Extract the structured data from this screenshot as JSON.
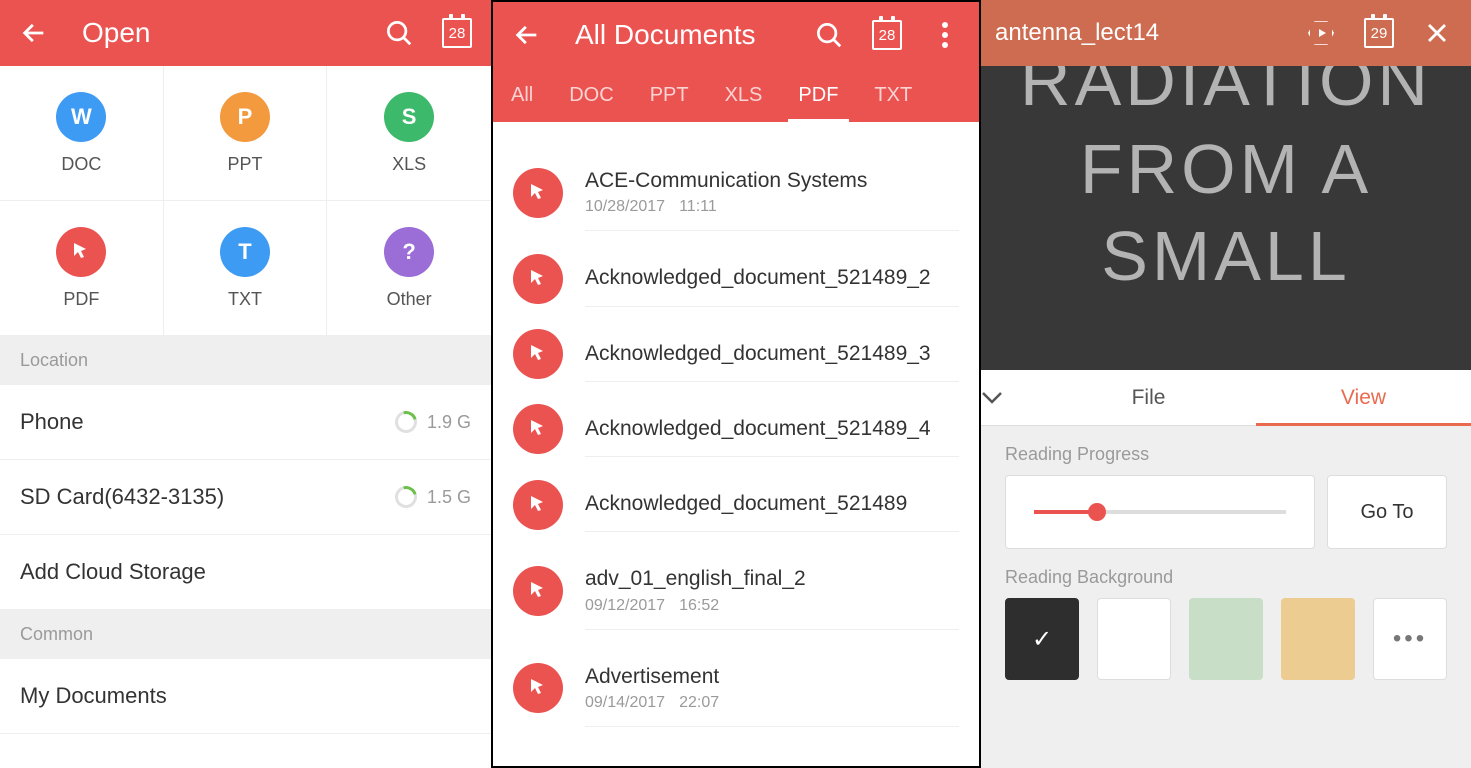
{
  "panel1": {
    "title": "Open",
    "calendar_badge": "28",
    "types": [
      {
        "label": "DOC",
        "icon": "W",
        "color": "#3E9BF4"
      },
      {
        "label": "PPT",
        "icon": "P",
        "color": "#F39A3E"
      },
      {
        "label": "XLS",
        "icon": "S",
        "color": "#3DB96B"
      },
      {
        "label": "PDF",
        "icon": "pdf",
        "color": "#EB5351"
      },
      {
        "label": "TXT",
        "icon": "T",
        "color": "#3E9BF4"
      },
      {
        "label": "Other",
        "icon": "?",
        "color": "#9A6DD7"
      }
    ],
    "section_location": "Location",
    "locations": [
      {
        "name": "Phone",
        "size": "1.9 G"
      },
      {
        "name": "SD Card(6432-3135)",
        "size": "1.5 G"
      }
    ],
    "add_cloud": "Add Cloud Storage",
    "section_common": "Common",
    "my_docs": "My Documents"
  },
  "panel2": {
    "title": "All Documents",
    "calendar_badge": "28",
    "tabs": [
      "All",
      "DOC",
      "PPT",
      "XLS",
      "PDF",
      "TXT"
    ],
    "active_tab": "PDF",
    "files": [
      {
        "name": "ACE-Communication Systems",
        "date": "10/28/2017",
        "time": "11:11"
      },
      {
        "name": "Acknowledged_document_521489_2"
      },
      {
        "name": "Acknowledged_document_521489_3"
      },
      {
        "name": "Acknowledged_document_521489_4"
      },
      {
        "name": "Acknowledged_document_521489"
      },
      {
        "name": "adv_01_english_final_2",
        "date": "09/12/2017",
        "time": "16:52"
      },
      {
        "name": "Advertisement",
        "date": "09/14/2017",
        "time": "22:07"
      }
    ]
  },
  "panel3": {
    "title": "antenna_lect14",
    "calendar_badge": "29",
    "doc_lines": [
      "RADIATION",
      "FROM A",
      "SMALL"
    ],
    "sheet_tabs": [
      "File",
      "View"
    ],
    "active_sheet_tab": "View",
    "reading_progress_label": "Reading Progress",
    "goto_label": "Go To",
    "reading_bg_label": "Reading Background",
    "progress_percent": 25
  }
}
